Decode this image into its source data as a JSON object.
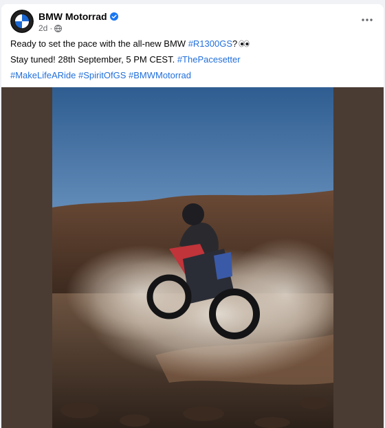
{
  "post": {
    "page_name": "BMW Motorrad",
    "time": "2d",
    "separator": "·",
    "more_icon": "more-horizontal-icon",
    "line1_text": "Ready to set the pace with the all-new BMW ",
    "line1_hashtag": "#R1300GS",
    "line1_suffix": "?",
    "line2_text": "Stay tuned! 28th September, 5 PM CEST. ",
    "line2_hashtag": "#ThePacesetter",
    "hashtags": [
      "#MakeLifeARide",
      "#SpiritOfGS",
      "#BMWMotorrad"
    ],
    "icons": {
      "avatar": "bmw-roundel-logo",
      "verified": "verified-badge-icon",
      "audience": "globe-icon",
      "emoji": "eyes-emoji-icon"
    },
    "colors": {
      "link": "#216fdb",
      "verified": "#1877f2",
      "letterbox": "#4a3c33"
    }
  }
}
